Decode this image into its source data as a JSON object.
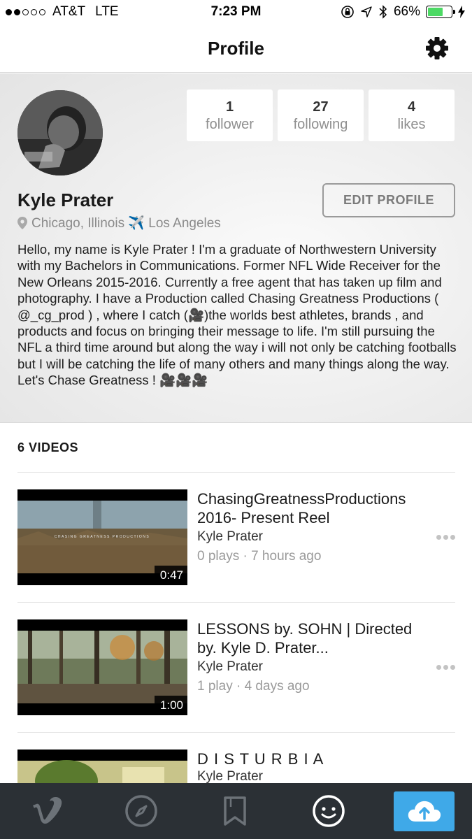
{
  "status_bar": {
    "carrier": "AT&T",
    "network": "LTE",
    "time": "7:23 PM",
    "battery_percent": "66%",
    "battery_level": 0.66,
    "signal_bars_filled": 2,
    "signal_bars_total": 5
  },
  "nav": {
    "title": "Profile"
  },
  "profile": {
    "name": "Kyle Prater",
    "location": "Chicago, Illinois ✈️ Los Angeles",
    "edit_label": "EDIT PROFILE",
    "bio": "Hello, my name is Kyle Prater ! I'm a graduate of Northwestern University with my Bachelors in Communications. Former NFL Wide Receiver for the New Orleans 2015-2016. Currently a free agent that has taken up film and photography. I have a Production called Chasing Greatness Productions ( @_cg_prod ) , where I catch (🎥)the worlds best athletes, brands , and products and focus on bringing their message to life.  I'm still pursuing the NFL a third time around but along the way i will not only be catching footballs but I will be catching the life of many others and many things along the way. Let's Chase Greatness ! 🎥🎥🎥",
    "stats": [
      {
        "value": "1",
        "label": "follower"
      },
      {
        "value": "27",
        "label": "following"
      },
      {
        "value": "4",
        "label": "likes"
      }
    ]
  },
  "videos": {
    "heading": "6 VIDEOS",
    "items": [
      {
        "title": "ChasingGreatnessProductions 2016- Present Reel",
        "author": "Kyle Prater",
        "meta": "0 plays · 7 hours ago",
        "duration": "0:47",
        "thumb_text": "CHASING GREATNESS PRODUCTIONS"
      },
      {
        "title": "LESSONS by. SOHN | Directed by. Kyle D. Prater...",
        "author": "Kyle Prater",
        "meta": "1 play · 4 days ago",
        "duration": "1:00"
      },
      {
        "title": "D I S T U R B I A",
        "author": "Kyle Prater",
        "meta": "",
        "duration": ""
      }
    ]
  },
  "tab_bar": {
    "tabs": [
      "vimeo-icon",
      "explore-icon",
      "watchlater-icon",
      "me-icon",
      "upload-icon"
    ],
    "active": "me-icon",
    "upload_color": "#3fa9e8"
  },
  "colors": {
    "battery": "#4cd964",
    "tab_bar_bg": "#2b3035",
    "accent": "#3fa9e8"
  }
}
